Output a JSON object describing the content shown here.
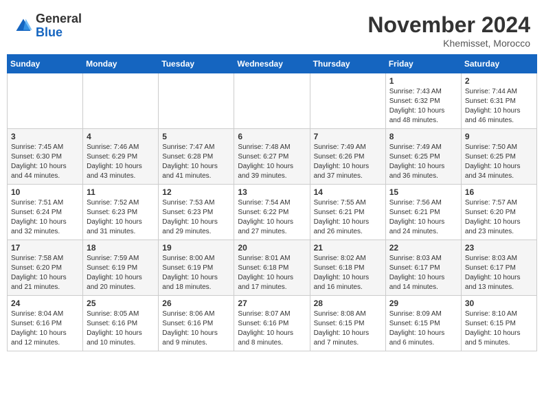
{
  "header": {
    "logo_line1": "General",
    "logo_line2": "Blue",
    "month_title": "November 2024",
    "location": "Khemisset, Morocco"
  },
  "weekdays": [
    "Sunday",
    "Monday",
    "Tuesday",
    "Wednesday",
    "Thursday",
    "Friday",
    "Saturday"
  ],
  "weeks": [
    [
      {
        "day": "",
        "info": ""
      },
      {
        "day": "",
        "info": ""
      },
      {
        "day": "",
        "info": ""
      },
      {
        "day": "",
        "info": ""
      },
      {
        "day": "",
        "info": ""
      },
      {
        "day": "1",
        "info": "Sunrise: 7:43 AM\nSunset: 6:32 PM\nDaylight: 10 hours and 48 minutes."
      },
      {
        "day": "2",
        "info": "Sunrise: 7:44 AM\nSunset: 6:31 PM\nDaylight: 10 hours and 46 minutes."
      }
    ],
    [
      {
        "day": "3",
        "info": "Sunrise: 7:45 AM\nSunset: 6:30 PM\nDaylight: 10 hours and 44 minutes."
      },
      {
        "day": "4",
        "info": "Sunrise: 7:46 AM\nSunset: 6:29 PM\nDaylight: 10 hours and 43 minutes."
      },
      {
        "day": "5",
        "info": "Sunrise: 7:47 AM\nSunset: 6:28 PM\nDaylight: 10 hours and 41 minutes."
      },
      {
        "day": "6",
        "info": "Sunrise: 7:48 AM\nSunset: 6:27 PM\nDaylight: 10 hours and 39 minutes."
      },
      {
        "day": "7",
        "info": "Sunrise: 7:49 AM\nSunset: 6:26 PM\nDaylight: 10 hours and 37 minutes."
      },
      {
        "day": "8",
        "info": "Sunrise: 7:49 AM\nSunset: 6:25 PM\nDaylight: 10 hours and 36 minutes."
      },
      {
        "day": "9",
        "info": "Sunrise: 7:50 AM\nSunset: 6:25 PM\nDaylight: 10 hours and 34 minutes."
      }
    ],
    [
      {
        "day": "10",
        "info": "Sunrise: 7:51 AM\nSunset: 6:24 PM\nDaylight: 10 hours and 32 minutes."
      },
      {
        "day": "11",
        "info": "Sunrise: 7:52 AM\nSunset: 6:23 PM\nDaylight: 10 hours and 31 minutes."
      },
      {
        "day": "12",
        "info": "Sunrise: 7:53 AM\nSunset: 6:23 PM\nDaylight: 10 hours and 29 minutes."
      },
      {
        "day": "13",
        "info": "Sunrise: 7:54 AM\nSunset: 6:22 PM\nDaylight: 10 hours and 27 minutes."
      },
      {
        "day": "14",
        "info": "Sunrise: 7:55 AM\nSunset: 6:21 PM\nDaylight: 10 hours and 26 minutes."
      },
      {
        "day": "15",
        "info": "Sunrise: 7:56 AM\nSunset: 6:21 PM\nDaylight: 10 hours and 24 minutes."
      },
      {
        "day": "16",
        "info": "Sunrise: 7:57 AM\nSunset: 6:20 PM\nDaylight: 10 hours and 23 minutes."
      }
    ],
    [
      {
        "day": "17",
        "info": "Sunrise: 7:58 AM\nSunset: 6:20 PM\nDaylight: 10 hours and 21 minutes."
      },
      {
        "day": "18",
        "info": "Sunrise: 7:59 AM\nSunset: 6:19 PM\nDaylight: 10 hours and 20 minutes."
      },
      {
        "day": "19",
        "info": "Sunrise: 8:00 AM\nSunset: 6:19 PM\nDaylight: 10 hours and 18 minutes."
      },
      {
        "day": "20",
        "info": "Sunrise: 8:01 AM\nSunset: 6:18 PM\nDaylight: 10 hours and 17 minutes."
      },
      {
        "day": "21",
        "info": "Sunrise: 8:02 AM\nSunset: 6:18 PM\nDaylight: 10 hours and 16 minutes."
      },
      {
        "day": "22",
        "info": "Sunrise: 8:03 AM\nSunset: 6:17 PM\nDaylight: 10 hours and 14 minutes."
      },
      {
        "day": "23",
        "info": "Sunrise: 8:03 AM\nSunset: 6:17 PM\nDaylight: 10 hours and 13 minutes."
      }
    ],
    [
      {
        "day": "24",
        "info": "Sunrise: 8:04 AM\nSunset: 6:16 PM\nDaylight: 10 hours and 12 minutes."
      },
      {
        "day": "25",
        "info": "Sunrise: 8:05 AM\nSunset: 6:16 PM\nDaylight: 10 hours and 10 minutes."
      },
      {
        "day": "26",
        "info": "Sunrise: 8:06 AM\nSunset: 6:16 PM\nDaylight: 10 hours and 9 minutes."
      },
      {
        "day": "27",
        "info": "Sunrise: 8:07 AM\nSunset: 6:16 PM\nDaylight: 10 hours and 8 minutes."
      },
      {
        "day": "28",
        "info": "Sunrise: 8:08 AM\nSunset: 6:15 PM\nDaylight: 10 hours and 7 minutes."
      },
      {
        "day": "29",
        "info": "Sunrise: 8:09 AM\nSunset: 6:15 PM\nDaylight: 10 hours and 6 minutes."
      },
      {
        "day": "30",
        "info": "Sunrise: 8:10 AM\nSunset: 6:15 PM\nDaylight: 10 hours and 5 minutes."
      }
    ]
  ]
}
